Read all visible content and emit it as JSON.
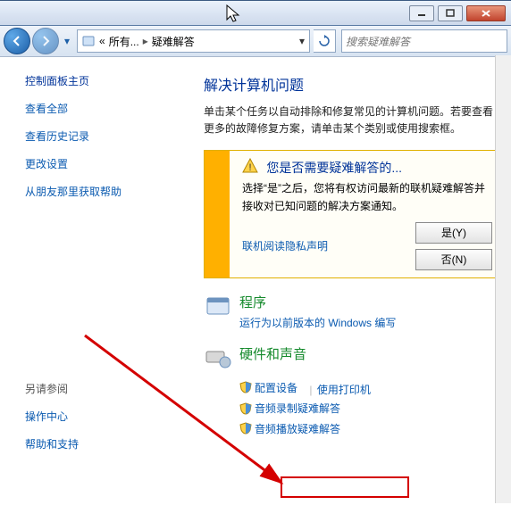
{
  "titlebar": {},
  "nav": {
    "crumb_root": "«",
    "crumb_1": "所有...",
    "crumb_2": "疑难解答",
    "search_placeholder": "搜索疑难解答"
  },
  "sidebar": {
    "heading": "控制面板主页",
    "links": [
      "查看全部",
      "查看历史记录",
      "更改设置",
      "从朋友那里获取帮助"
    ],
    "also_heading": "另请参阅",
    "also_links": [
      "操作中心",
      "帮助和支持"
    ]
  },
  "main": {
    "heading": "解决计算机问题",
    "para": "单击某个任务以自动排除和修复常见的计算机问题。若要查看更多的故障修复方案，请单击某个类别或使用搜索框。",
    "info": {
      "title": "您是否需要疑难解答的...",
      "text": "选择“是”之后，您将有权访问最新的联机疑难解答并接收对已知问题的解决方案通知。",
      "privacy_link": "联机阅读隐私声明",
      "yes": "是(Y)",
      "no": "否(N)"
    },
    "cat_program": {
      "title": "程序",
      "sub": "运行为以前版本的 Windows 编写"
    },
    "cat_hw": {
      "title": "硬件和声音",
      "link_1": "配置设备",
      "link_2": "使用打印机",
      "link_3": "音频录制疑难解答",
      "link_4": "音频播放疑难解答"
    }
  }
}
